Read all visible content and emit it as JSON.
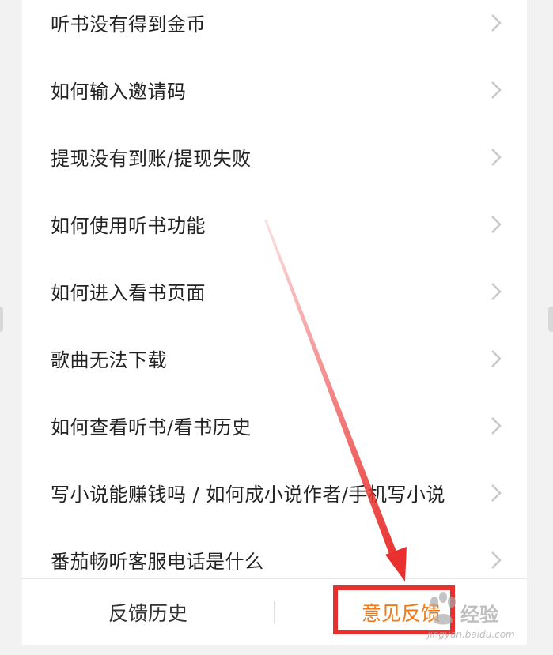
{
  "faq": {
    "items": [
      {
        "label": "听书没有得到金币"
      },
      {
        "label": "如何输入邀请码"
      },
      {
        "label": "提现没有到账/提现失败"
      },
      {
        "label": "如何使用听书功能"
      },
      {
        "label": "如何进入看书页面"
      },
      {
        "label": "歌曲无法下载"
      },
      {
        "label": "如何查看听书/看书历史"
      },
      {
        "label": "写小说能赚钱吗 / 如何成小说作者/手机写小说"
      },
      {
        "label": "番茄畅听客服电话是什么"
      }
    ]
  },
  "bottom_bar": {
    "history_label": "反馈历史",
    "feedback_label": "意见反馈"
  },
  "watermark": {
    "main": "经验",
    "sub": "jingyan.baidu.com"
  },
  "colors": {
    "accent": "#f07a1a",
    "highlight": "#e8312f",
    "text": "#222222",
    "chevron": "#c8c8c8"
  },
  "icons": [
    "chevron-right-icon",
    "annotation-arrow",
    "baidu-paw-icon"
  ]
}
